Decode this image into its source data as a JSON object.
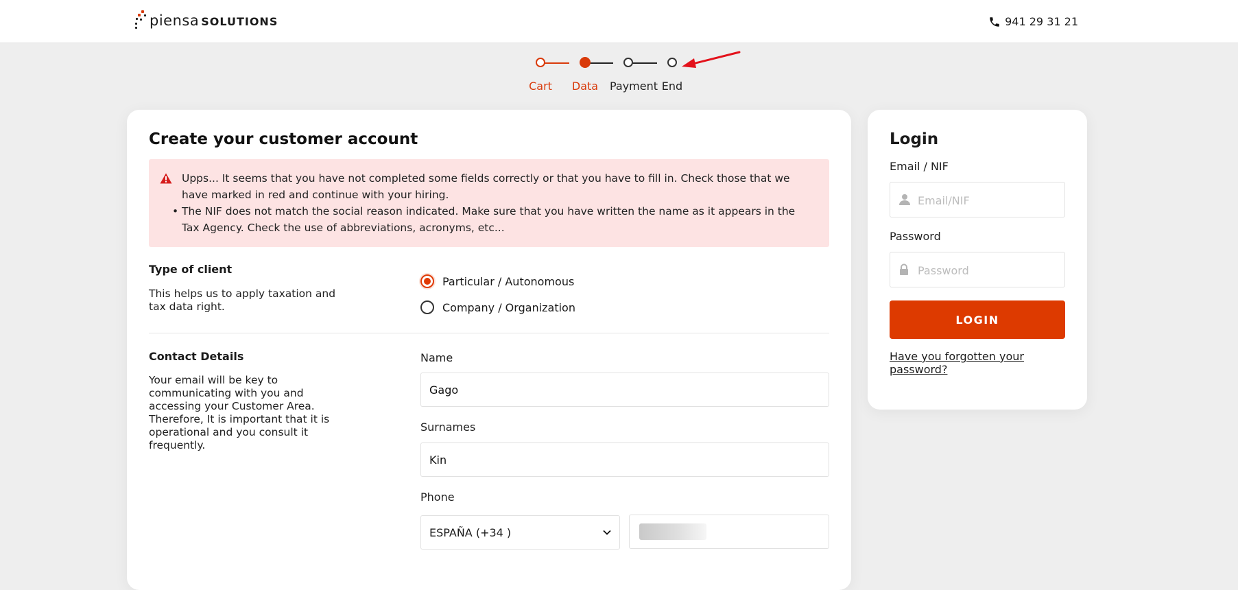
{
  "header": {
    "logo_light": "piensa",
    "logo_bold": "SOLUTIONS",
    "phone": "941 29 31 21",
    "phone_icon": "phone-icon"
  },
  "stepper": {
    "steps": [
      {
        "label": "Cart",
        "state": "done"
      },
      {
        "label": "Data",
        "state": "current"
      },
      {
        "label": "Payment",
        "state": "pending"
      },
      {
        "label": "End",
        "state": "pending"
      }
    ],
    "colors": {
      "active": "#d93a0a",
      "pending": "#333333"
    }
  },
  "annotation": {
    "arrow_color": "#e3121b"
  },
  "register": {
    "title": "Create your customer account",
    "alert": {
      "icon": "warning-icon",
      "message": "Upps... It seems that you have not completed some fields correctly or that you have to fill in. Check those that we have marked in red and continue with your hiring.",
      "bullets": [
        "The NIF does not match the social reason indicated. Make sure that you have written the name as it appears in the Tax Agency. Check the use of abbreviations, acronyms, etc..."
      ],
      "background": "#fde3e3"
    },
    "client_type": {
      "heading": "Type of client",
      "description": "This helps us to apply taxation and tax data right.",
      "options": [
        {
          "label": "Particular / Autonomous",
          "selected": true
        },
        {
          "label": "Company / Organization",
          "selected": false
        }
      ]
    },
    "contact": {
      "heading": "Contact Details",
      "description": "Your email will be key to communicating with you and accessing your Customer Area. Therefore, It is important that it is operational and you consult it frequently.",
      "name_label": "Name",
      "name_value": "Gago",
      "surnames_label": "Surnames",
      "surnames_value": "Kin",
      "phone_label": "Phone",
      "country_value": "ESPAÑA (+34 )"
    }
  },
  "login": {
    "title": "Login",
    "email_label": "Email / NIF",
    "email_placeholder": "Email/NIF",
    "password_label": "Password",
    "password_placeholder": "Password",
    "button": "LOGIN",
    "forgot": "Have you forgotten your password?",
    "accent": "#dd3a00"
  }
}
